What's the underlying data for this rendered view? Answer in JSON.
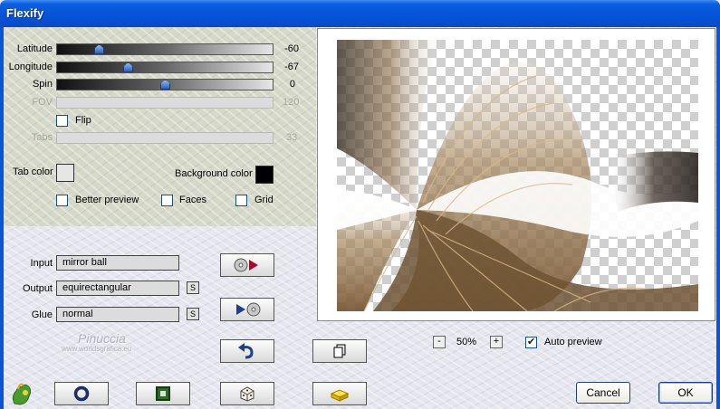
{
  "window": {
    "title": "Flexify"
  },
  "sliders": [
    {
      "label": "Latitude",
      "value": "-60",
      "fraction": 0.18,
      "enabled": true
    },
    {
      "label": "Longitude",
      "value": "-67",
      "fraction": 0.32,
      "enabled": true
    },
    {
      "label": "Spin",
      "value": "0",
      "fraction": 0.5,
      "enabled": true
    },
    {
      "label": "FOV",
      "value": "120",
      "enabled": false
    }
  ],
  "flip": {
    "label": "Flip",
    "checked": false
  },
  "tabs": {
    "label": "Tabs",
    "value": "33",
    "enabled": false
  },
  "tab_color": {
    "label": "Tab color",
    "color": "#e6e6e6"
  },
  "background_color": {
    "label": "Background color",
    "color": "#000000"
  },
  "options": {
    "better_preview": {
      "label": "Better preview",
      "checked": false
    },
    "faces": {
      "label": "Faces",
      "checked": false
    },
    "grid": {
      "label": "Grid",
      "checked": false
    }
  },
  "projection": {
    "input": {
      "label": "Input",
      "value": "mirror ball"
    },
    "output": {
      "label": "Output",
      "value": "equirectangular",
      "button": "S"
    },
    "glue": {
      "label": "Glue",
      "value": "normal",
      "button": "S"
    }
  },
  "watermark": {
    "name": "Pinuccia",
    "url": "www.worldsgrafica.eu"
  },
  "zoom": {
    "minus": "-",
    "value": "50%",
    "plus": "+"
  },
  "auto_preview": {
    "label": "Auto preview",
    "checked": true
  },
  "buttons": {
    "cancel": "Cancel",
    "ok": "OK"
  },
  "icons": {
    "input_convert": "cd-play-icon",
    "output_convert": "play-cd-icon",
    "undo": "undo-arrow-icon",
    "copy": "copy-icon",
    "logo": "flaming-pear-logo",
    "circle": "circle-tool-icon",
    "square": "square-tool-icon",
    "dice": "dice-icon",
    "brick": "brick-icon"
  }
}
